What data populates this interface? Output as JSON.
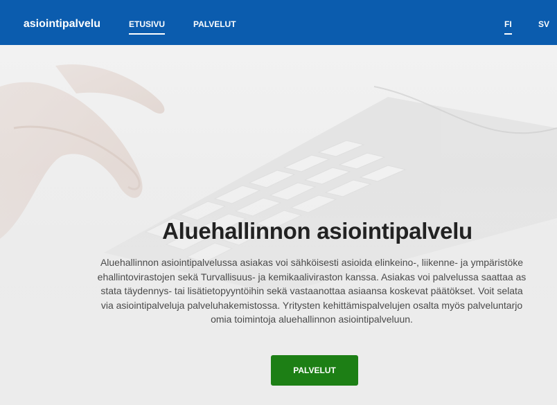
{
  "header": {
    "brand": "asiointipalvelu",
    "nav": [
      {
        "label": "ETUSIVU",
        "active": true
      },
      {
        "label": "PALVELUT",
        "active": false
      }
    ],
    "languages": [
      {
        "label": "FI",
        "active": true
      },
      {
        "label": "SV",
        "active": false
      }
    ],
    "background_color": "#0b5cae"
  },
  "hero": {
    "title": "Aluehallinnon asiointipalvelu",
    "description_lines": [
      "Aluehallinnon asiointipalvelussa asiakas voi sähköisesti asioida elinkeino-, liikenne- ja ympäristöke",
      "ehallintovirastojen sekä Turvallisuus- ja kemikaaliviraston kanssa. Asiakas voi palvelussa saattaa as",
      "stata täydennys- tai lisätietopyyntöihin sekä vastaanottaa asiaansa koskevat päätökset. Voit selata",
      "via asiointipalveluja palveluhakemistossa. Yritysten kehittämispalvelujen osalta myös palveluntarjo",
      "omia toimintoja aluehallinnon asiointipalveluun."
    ],
    "cta_label": "PALVELUT",
    "cta_color": "#1d7f15",
    "background_image": "hands typing on keyboard"
  }
}
